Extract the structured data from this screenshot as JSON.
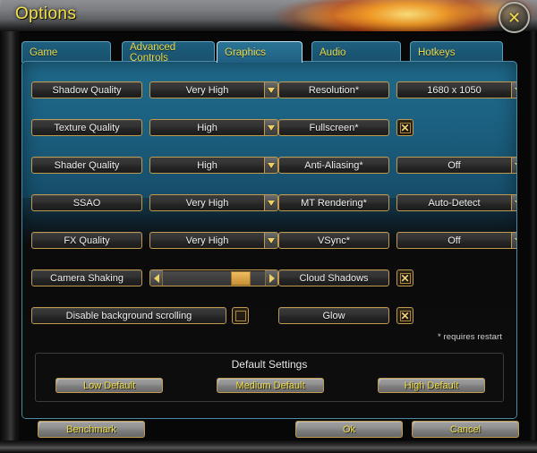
{
  "window": {
    "title": "Options",
    "close_icon": "close-x-icon"
  },
  "tabs": [
    {
      "label": "Game",
      "active": false
    },
    {
      "label": "Advanced Controls",
      "active": false
    },
    {
      "label": "Graphics",
      "active": true
    },
    {
      "label": "Audio",
      "active": false
    },
    {
      "label": "Hotkeys",
      "active": false
    }
  ],
  "settings": {
    "left_column": [
      {
        "label": "Shadow Quality",
        "type": "dropdown",
        "value": "Very High"
      },
      {
        "label": "Texture Quality",
        "type": "dropdown",
        "value": "High"
      },
      {
        "label": "Shader Quality",
        "type": "dropdown",
        "value": "High"
      },
      {
        "label": "SSAO",
        "type": "dropdown",
        "value": "Very High"
      },
      {
        "label": "FX Quality",
        "type": "dropdown",
        "value": "Very High"
      },
      {
        "label": "Camera Shaking",
        "type": "slider",
        "value": 86
      },
      {
        "label": "Disable background scrolling",
        "type": "checkbox",
        "checked": false
      }
    ],
    "right_column": [
      {
        "label": "Resolution*",
        "type": "dropdown",
        "value": "1680 x 1050"
      },
      {
        "label": "Fullscreen*",
        "type": "checkbox",
        "checked": true
      },
      {
        "label": "Anti-Aliasing*",
        "type": "dropdown",
        "value": "Off"
      },
      {
        "label": "MT Rendering*",
        "type": "dropdown",
        "value": "Auto-Detect"
      },
      {
        "label": "VSync*",
        "type": "dropdown",
        "value": "Off"
      },
      {
        "label": "Cloud Shadows",
        "type": "checkbox",
        "checked": true
      },
      {
        "label": "Glow",
        "type": "checkbox",
        "checked": true
      }
    ],
    "restart_note": "* requires restart",
    "checked_mark": "✕"
  },
  "defaults": {
    "title": "Default Settings",
    "buttons": [
      {
        "label": "Low Default"
      },
      {
        "label": "Medium Default"
      },
      {
        "label": "High Default"
      }
    ]
  },
  "footer": {
    "benchmark": "Benchmark",
    "ok": "Ok",
    "cancel": "Cancel"
  },
  "colors": {
    "accent_gold": "#c09a4e",
    "text_yellow": "#f0dd45",
    "panel_blue": "#1f6a8c",
    "tab_blue": "#1b5876"
  }
}
